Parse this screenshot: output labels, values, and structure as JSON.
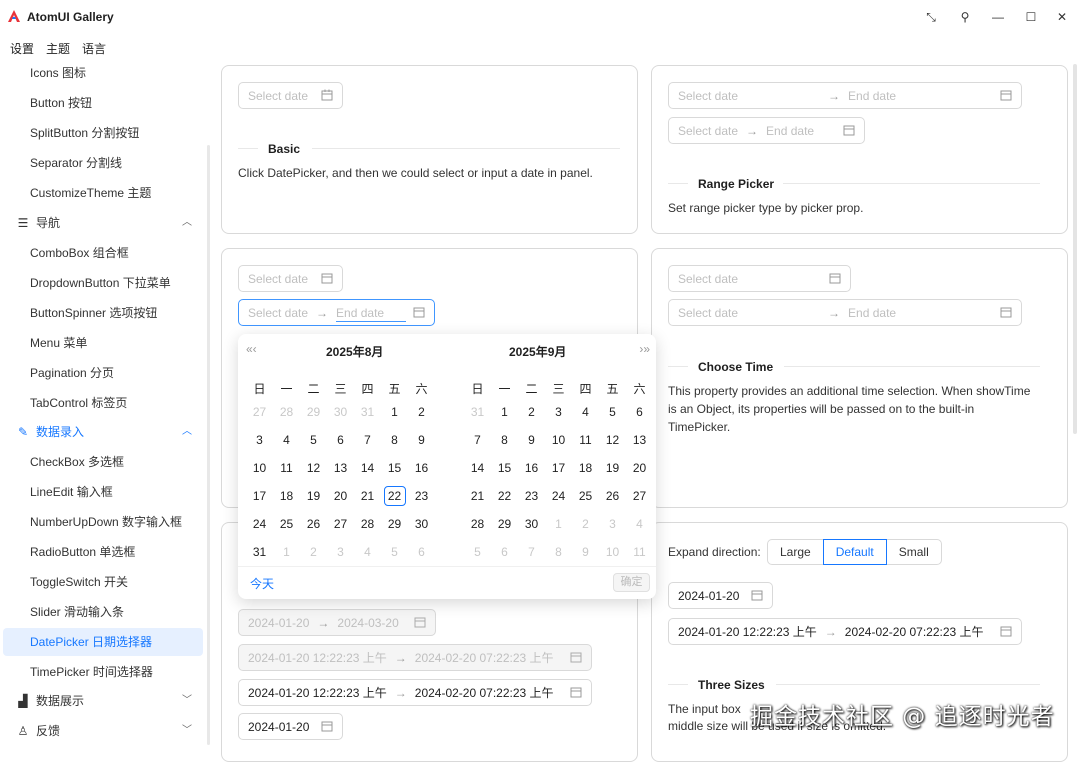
{
  "app": {
    "title": "AtomUI Gallery"
  },
  "menubar": [
    "设置",
    "主题",
    "语言"
  ],
  "sidebar": {
    "items_top": [
      "Icons 图标",
      "Button 按钮",
      "SplitButton 分割按钮",
      "Separator 分割线",
      "CustomizeTheme 主题"
    ],
    "group_nav": "导航",
    "items_nav": [
      "ComboBox 组合框",
      "DropdownButton 下拉菜单",
      "ButtonSpinner 选项按钮",
      "Menu 菜单",
      "Pagination 分页",
      "TabControl 标签页"
    ],
    "group_input": "数据录入",
    "items_input": [
      "CheckBox 多选框",
      "LineEdit 输入框",
      "NumberUpDown 数字输入框",
      "RadioButton 单选框",
      "ToggleSwitch 开关",
      "Slider 滑动输入条",
      "DatePicker 日期选择器",
      "TimePicker 时间选择器"
    ],
    "group_display": "数据展示",
    "group_feedback": "反馈"
  },
  "picker": {
    "select_date": "Select date",
    "end_date": "End date",
    "arrow": "→"
  },
  "basic": {
    "title": "Basic",
    "desc": "Click DatePicker, and then we could select or input a date in panel."
  },
  "range": {
    "title": "Range Picker",
    "desc": "Set range picker type by picker prop."
  },
  "choose_time": {
    "title": "Choose Time",
    "desc1": "This property provides an additional time selection. When showTime",
    "desc2": "is an Object, its properties will be passed on to the built-in",
    "desc3": "TimePicker."
  },
  "calendar": {
    "left_title": "2025年8月",
    "right_title": "2025年9月",
    "weekdays": [
      "日",
      "一",
      "二",
      "三",
      "四",
      "五",
      "六"
    ],
    "prev": "«‹",
    "next": "›»",
    "today": "今天",
    "ok": "确定"
  },
  "left_values": {
    "date": "2024-01-20",
    "range_start": "2024-01-20",
    "range_end": "2024-03-20",
    "dt_start": "2024-01-20 12:22:23 上午",
    "dt_end": "2024-02-20 07:22:23 上午"
  },
  "three_sizes": {
    "title": "Three Sizes",
    "expand_label": "Expand direction:",
    "options": [
      "Large",
      "Default",
      "Small"
    ],
    "desc1": "The input box",
    "desc2": "middle size will be used if size is omitted.",
    "date": "2024-01-20",
    "dt_start": "2024-01-20 12:22:23 上午",
    "dt_end": "2024-02-20 07:22:23 上午"
  },
  "watermark": "掘金技术社区 @ 追逐时光者",
  "colors": {
    "accent": "#1677ff",
    "selected_bg": "#e6f0ff"
  },
  "icons": {
    "logo": "atom-logo",
    "calendar": "calendar-icon"
  }
}
